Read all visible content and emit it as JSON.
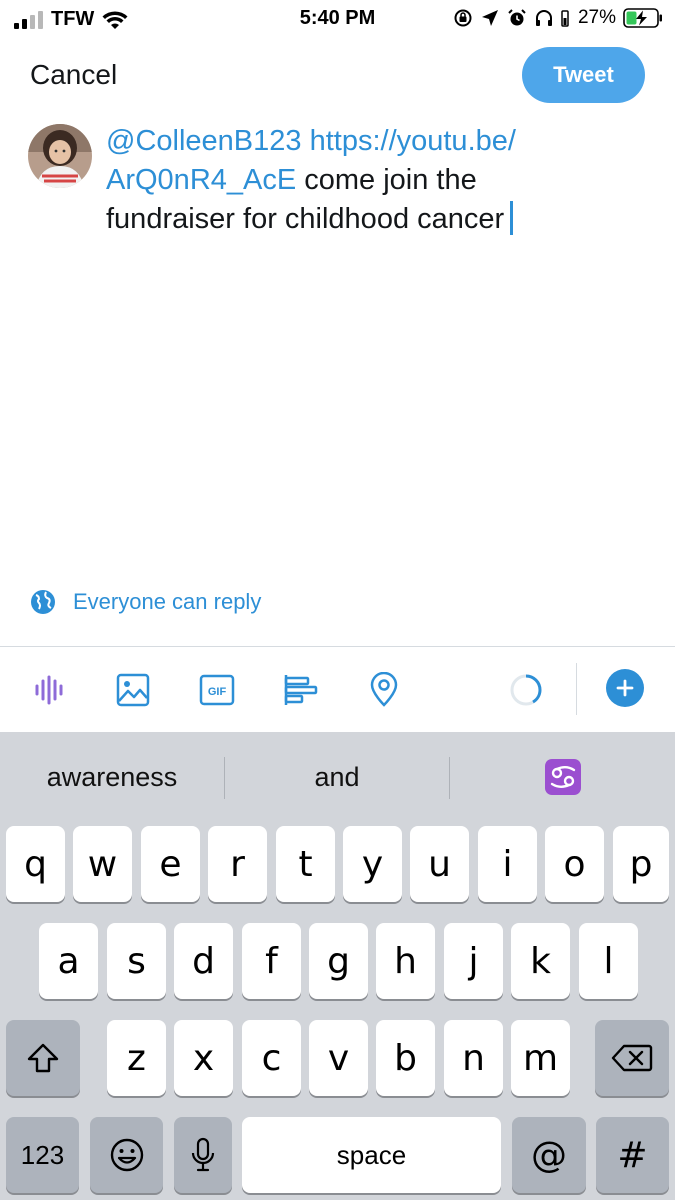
{
  "status_bar": {
    "carrier": "TFW",
    "time": "5:40 PM",
    "battery_percent": "27%"
  },
  "nav": {
    "cancel_label": "Cancel",
    "tweet_label": "Tweet"
  },
  "compose": {
    "mention": "@ColleenB123",
    "link_part1": "https://youtu.be/",
    "link_part2": "ArQ0nR4_AcE",
    "text_part1": "come join the",
    "text_part2": "fundraiser for childhood cancer"
  },
  "reply_setting": {
    "label": "Everyone can reply",
    "icon": "globe-icon"
  },
  "toolbar": {
    "items": [
      "voice-icon",
      "image-icon",
      "gif-icon",
      "poll-icon",
      "location-icon",
      "char-progress-icon",
      "add-thread-icon"
    ],
    "gif_text": "GIF"
  },
  "keyboard": {
    "suggestions": [
      "awareness",
      "and",
      "♋"
    ],
    "row1": [
      "q",
      "w",
      "e",
      "r",
      "t",
      "y",
      "u",
      "i",
      "o",
      "p"
    ],
    "row2": [
      "a",
      "s",
      "d",
      "f",
      "g",
      "h",
      "j",
      "k",
      "l"
    ],
    "row3": [
      "z",
      "x",
      "c",
      "v",
      "b",
      "n",
      "m"
    ],
    "bottom": {
      "numbers": "123",
      "space": "space",
      "at": "@",
      "hash": "#"
    }
  },
  "colors": {
    "accent": "#2d8fd6",
    "tweet_button": "#4ea6ea",
    "keyboard_bg": "#d2d5da"
  }
}
